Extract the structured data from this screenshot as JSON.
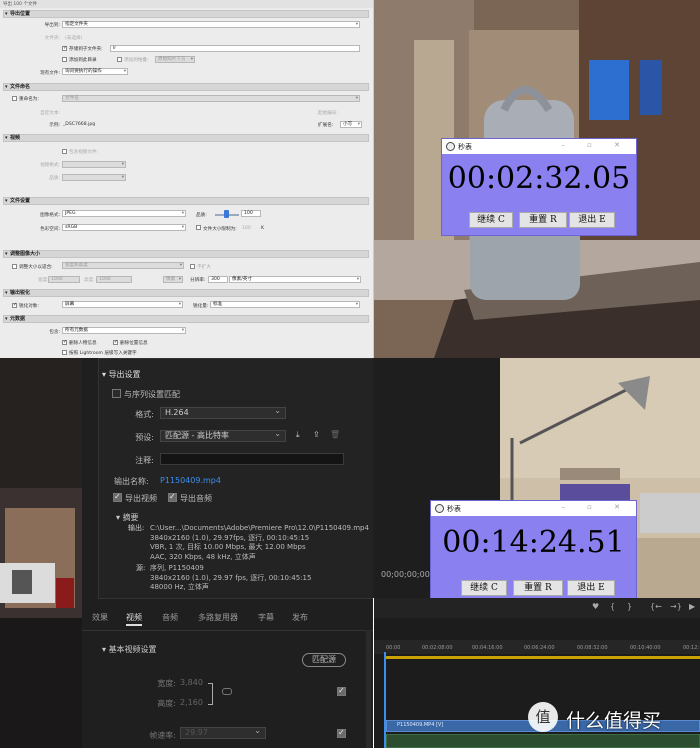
{
  "lightroom": {
    "title": "导出 100 个文件",
    "sections": {
      "export_location": "导出位置",
      "file_naming": "文件命名",
      "video": "视频",
      "file_settings": "文件设置",
      "image_sizing": "调整图像大小",
      "output_sharpening": "输出锐化",
      "metadata": "元数据"
    },
    "export_to_label": "导出到:",
    "export_to_value": "指定文件夹",
    "folder_label": "文件夹:",
    "folder_value": "(未选择)",
    "put_in_subfolder": "存储到子文件夹:",
    "subfolder_value": "lr",
    "add_to_catalog": "添加到此目录",
    "add_to_stack": "添加到堆叠:",
    "stack_value": "原始照片下方",
    "existing_files_label": "现有文件:",
    "existing_files_value": "询问要执行的操作",
    "rename_to": "重命名为:",
    "rename_value": "文件名",
    "custom_text": "自定文本:",
    "start_number": "起始编号:",
    "example_label": "示例:",
    "example_value": "_DSC7668.jpg",
    "extensions_label": "扩展名:",
    "extensions_value": "小写",
    "include_video": "包含视频文件:",
    "video_format": "视频格式:",
    "quality_video": "品质:",
    "image_format_label": "图像格式:",
    "image_format_value": "JPEG",
    "quality_label": "品质:",
    "quality_value": "100",
    "color_space_label": "色彩空间:",
    "color_space_value": "sRGB",
    "limit_size": "文件大小限制为:",
    "limit_value": "100",
    "limit_unit": "K",
    "resize_to_fit": "调整大小以适合:",
    "resize_mode": "宽度和高度",
    "dont_enlarge": "不扩大",
    "w_label": "宽度:",
    "w_value": "1000",
    "h_label": "高度:",
    "h_value": "1000",
    "px_unit": "像素",
    "resolution_label": "分辨率:",
    "resolution_value": "300",
    "res_unit": "像素/英寸",
    "sharpen_for": "锐化对象:",
    "sharpen_target": "屏幕",
    "amount_label": "锐化量:",
    "amount_value": "标准",
    "include_label": "包含:",
    "include_value": "所有元数据",
    "remove_person": "删除人物信息",
    "remove_location": "删除位置信息",
    "write_keywords": "按照 Lightroom 层级写入关键字"
  },
  "stopwatch1": {
    "title": "秒表",
    "time": "00:02:32.05",
    "btn_continue": "继续 C",
    "btn_reset": "重置 R",
    "btn_exit": "退出 E"
  },
  "stopwatch2": {
    "title": "秒表",
    "time": "00:14:24.51",
    "btn_continue": "继续 C",
    "btn_reset": "重置 R",
    "btn_exit": "退出 E"
  },
  "premiere": {
    "export_settings": "导出设置",
    "match_sequence": "与序列设置匹配",
    "format_label": "格式:",
    "format_value": "H.264",
    "preset_label": "预设:",
    "preset_value": "匹配源 - 高比特率",
    "comment_label": "注释:",
    "output_name_label": "输出名称:",
    "output_name_value": "P1150409.mp4",
    "export_video": "导出视频",
    "export_audio": "导出音频",
    "summary": "摘要",
    "output_label": "输出:",
    "output_lines": [
      "C:\\User...\\Documents\\Adobe\\Premiere Pro\\12.0\\P1150409.mp4",
      "3840x2160 (1.0),  29.97fps,  逐行,  00:10:45:15",
      "VBR,  1 次, 目标 10.00 Mbps, 最大 12.00 Mbps",
      "AAC, 320 Kbps, 48  kHz, 立体声"
    ],
    "source_label": "源:",
    "source_lines": [
      "序列, P1150409",
      "3840x2160 (1.0),  29.97 fps,  逐行,  00:10:45:15",
      "48000 Hz,  立体声"
    ],
    "tabs": [
      "效果",
      "视频",
      "音频",
      "多路复用器",
      "字幕",
      "发布"
    ],
    "basic_video": "基本视频设置",
    "match_source_btn": "匹配源",
    "width_label": "宽度:",
    "width_value": "3,840",
    "height_label": "高度:",
    "height_value": "2,160",
    "frame_rate_label": "帧速率:",
    "frame_rate_value": "29.97"
  },
  "timeline": {
    "timecode": "00;00;00;00",
    "ruler": [
      "00:00",
      "00:02:08:00",
      "00:04:16:00",
      "00:06:24:00",
      "00:08:32:00",
      "00:10:40:00",
      "00:12:"
    ],
    "clip_label": "P1150409.MP4 [V]"
  },
  "watermark": {
    "glyph": "值",
    "text": "什么值得买"
  }
}
